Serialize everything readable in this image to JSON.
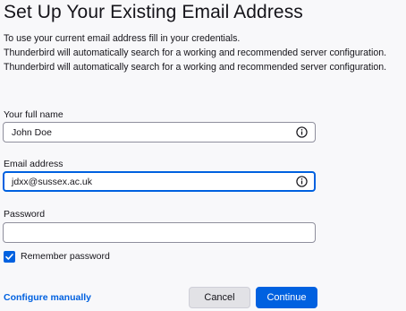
{
  "header": {
    "title": "Set Up Your Existing Email Address"
  },
  "intro": {
    "line1": "To use your current email address fill in your credentials.",
    "line2": "Thunderbird will automatically search for a working and recommended server configuration.",
    "line3": "Thunderbird will automatically search for a working and recommended server configuration."
  },
  "form": {
    "full_name": {
      "label": "Your full name",
      "value": "John Doe",
      "icon": "info-icon"
    },
    "email": {
      "label": "Email address",
      "value": "jdxx@sussex.ac.uk",
      "icon": "info-icon"
    },
    "password": {
      "label": "Password",
      "value": ""
    },
    "remember_password": {
      "label": "Remember password",
      "checked": true
    }
  },
  "footer": {
    "configure_manually": "Configure manually",
    "cancel_label": "Cancel",
    "continue_label": "Continue"
  },
  "colors": {
    "accent": "#0061e0",
    "background": "#f8f8fa",
    "text": "#15141a"
  }
}
